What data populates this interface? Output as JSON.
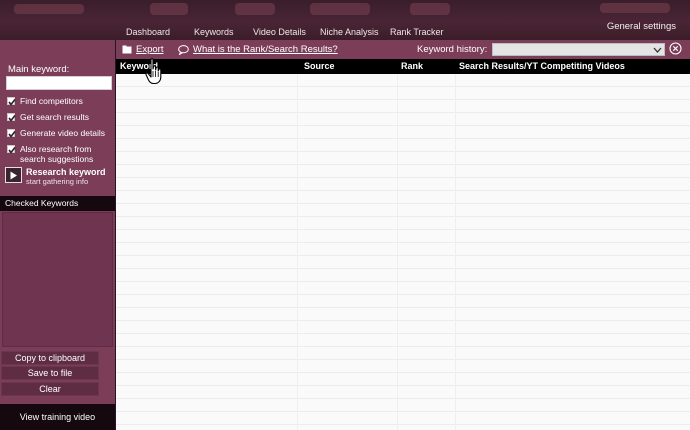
{
  "nav": {
    "tabs": [
      {
        "label": "Dashboard"
      },
      {
        "label": "Keywords"
      },
      {
        "label": "Video Details"
      },
      {
        "label": "Niche Analysis"
      },
      {
        "label": "Rank Tracker"
      }
    ],
    "settings_label": "General settings"
  },
  "sidebar": {
    "main_keyword_label": "Main keyword:",
    "main_keyword_value": "",
    "options": [
      {
        "label": "Find competitors",
        "checked": true
      },
      {
        "label": "Get search results",
        "checked": true
      },
      {
        "label": "Generate video details",
        "checked": true
      },
      {
        "label": "Also research from search suggestions",
        "checked": true
      }
    ],
    "research_button": {
      "title": "Research keyword",
      "subtitle": "start gathering info",
      "icon": "play-icon"
    },
    "checked_keywords_label": "Checked Keywords",
    "buttons": {
      "copy": "Copy to clipboard",
      "save": "Save to file",
      "clear": "Clear"
    },
    "training_video_label": "View training video"
  },
  "toolbar": {
    "export_label": "Export",
    "help_link": "What is the Rank/Search Results?",
    "history_label": "Keyword history:",
    "history_value": ""
  },
  "table": {
    "columns": [
      "Keyword",
      "Source",
      "Rank",
      "Search Results/YT Competiting Videos"
    ],
    "rows": []
  },
  "colors": {
    "sidebar": "#7b3d58",
    "header_bg": "#000000",
    "topbar": "#3a1e2a",
    "dark_panel": "#15090f"
  }
}
